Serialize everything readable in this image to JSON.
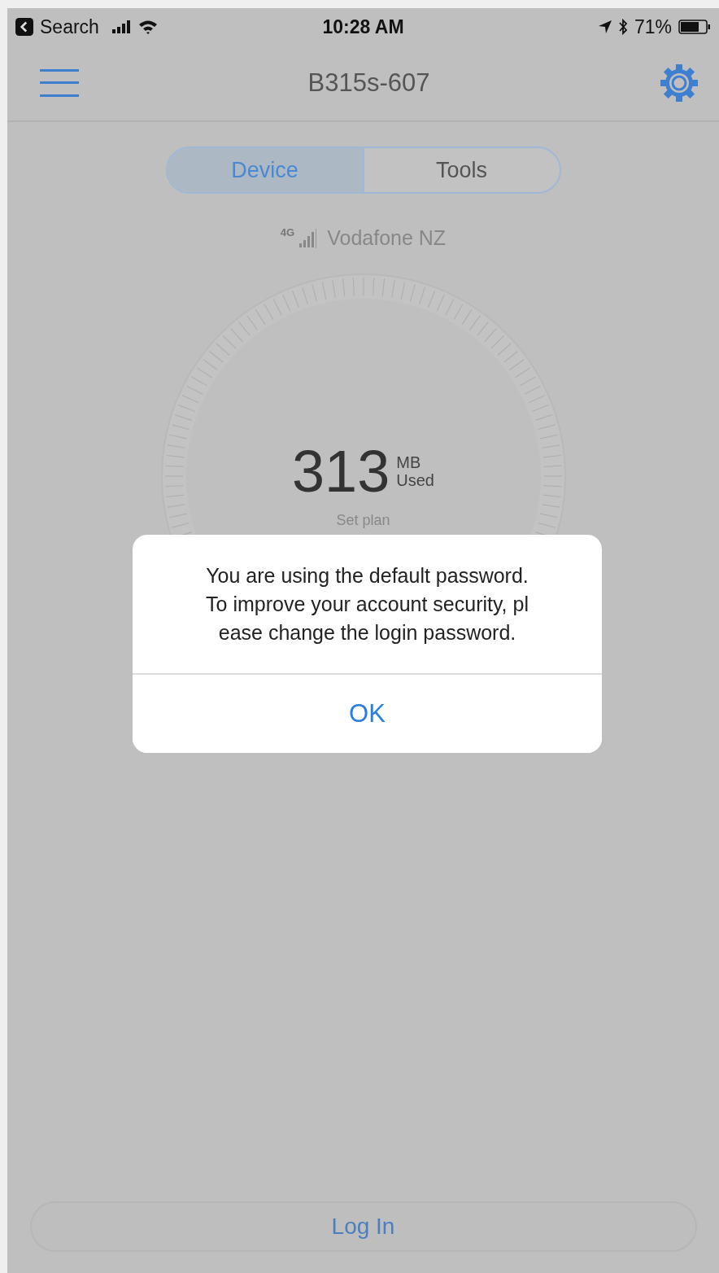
{
  "status_bar": {
    "back_label": "Search",
    "time": "10:28 AM",
    "battery": "71%"
  },
  "nav": {
    "title": "B315s-607"
  },
  "tabs": [
    {
      "label": "Device",
      "selected": true
    },
    {
      "label": "Tools",
      "selected": false
    }
  ],
  "network": {
    "type": "4G",
    "carrier": "Vodafone NZ"
  },
  "usage": {
    "value": "313",
    "unit": "MB",
    "caption": "Used",
    "plan_link": "Set plan"
  },
  "dialog": {
    "message_lines": [
      "You are using the default password.",
      "To improve your account security, pl",
      "ease change the login password."
    ],
    "button": "OK"
  },
  "login_button": "Log In"
}
